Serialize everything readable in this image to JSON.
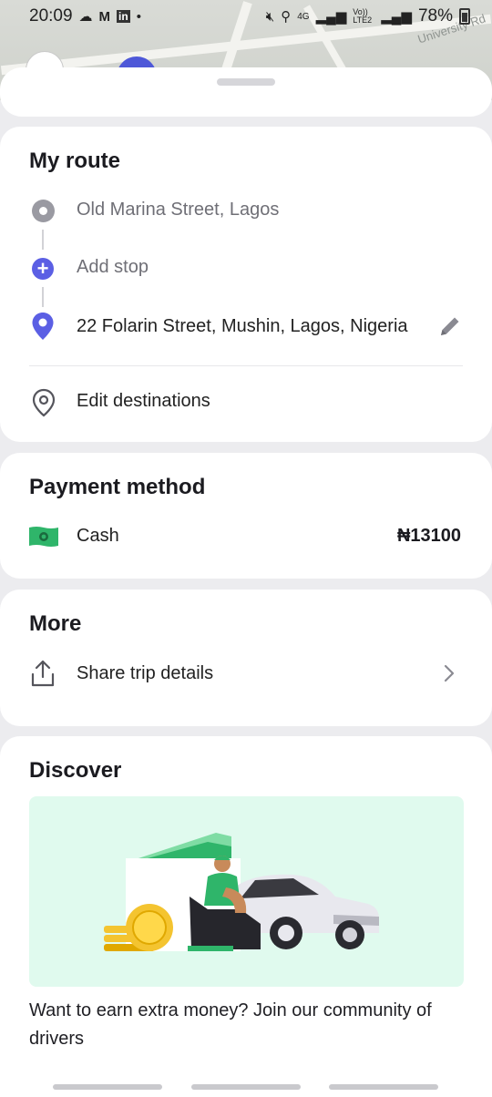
{
  "status_bar": {
    "time": "20:09",
    "left_icons": [
      "cloud-icon",
      "gmail-icon",
      "linkedin-icon",
      "dot-icon"
    ],
    "network_4g": "4G",
    "network_volte": "Vo)) LTE2",
    "battery": "78%"
  },
  "map": {
    "street_label": "University Rd"
  },
  "route": {
    "title": "My route",
    "pickup": "Old Marina Street, Lagos",
    "add_stop": "Add stop",
    "destination": "22 Folarin Street, Mushin, Lagos, Nigeria",
    "edit_destinations": "Edit destinations"
  },
  "payment": {
    "title": "Payment method",
    "method": "Cash",
    "amount": "₦13100"
  },
  "more": {
    "title": "More",
    "share": "Share trip details"
  },
  "discover": {
    "title": "Discover",
    "promo_text": "Want to earn extra money? Join our community of drivers"
  },
  "colors": {
    "accent": "#5b5fe4",
    "cash_green": "#2fb56a",
    "promo_bg": "#e0faee"
  }
}
